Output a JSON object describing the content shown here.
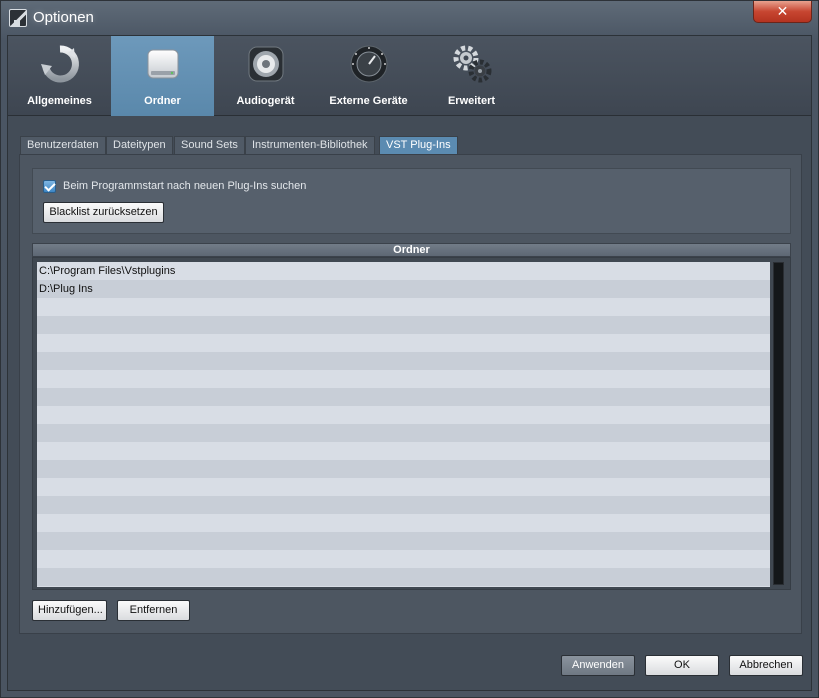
{
  "window": {
    "title": "Optionen",
    "close_label": "✕"
  },
  "categories": [
    {
      "label": "Allgemeines",
      "icon": "refresh-icon"
    },
    {
      "label": "Ordner",
      "icon": "disk-icon",
      "active": true
    },
    {
      "label": "Audiogerät",
      "icon": "speaker-icon"
    },
    {
      "label": "Externe Geräte",
      "icon": "knob-icon"
    },
    {
      "label": "Erweitert",
      "icon": "gears-icon"
    }
  ],
  "tabs": [
    {
      "label": "Benutzerdaten"
    },
    {
      "label": "Dateitypen"
    },
    {
      "label": "Sound Sets"
    },
    {
      "label": "Instrumenten-Bibliothek"
    },
    {
      "label": "VST Plug-Ins",
      "active": true
    }
  ],
  "settings": {
    "scan_on_start_label": "Beim Programmstart nach neuen Plug-Ins suchen",
    "scan_on_start_checked": true,
    "reset_blacklist_label": "Blacklist zurücksetzen"
  },
  "folders": {
    "header": "Ordner",
    "items": [
      "C:\\Program Files\\Vstplugins",
      "D:\\Plug Ins"
    ],
    "add_label": "Hinzufügen...",
    "remove_label": "Entfernen"
  },
  "footer": {
    "apply_label": "Anwenden",
    "ok_label": "OK",
    "cancel_label": "Abbrechen"
  },
  "colors": {
    "accent": "#5b8bb1",
    "close_red": "#c74631",
    "background": "#434c57"
  }
}
